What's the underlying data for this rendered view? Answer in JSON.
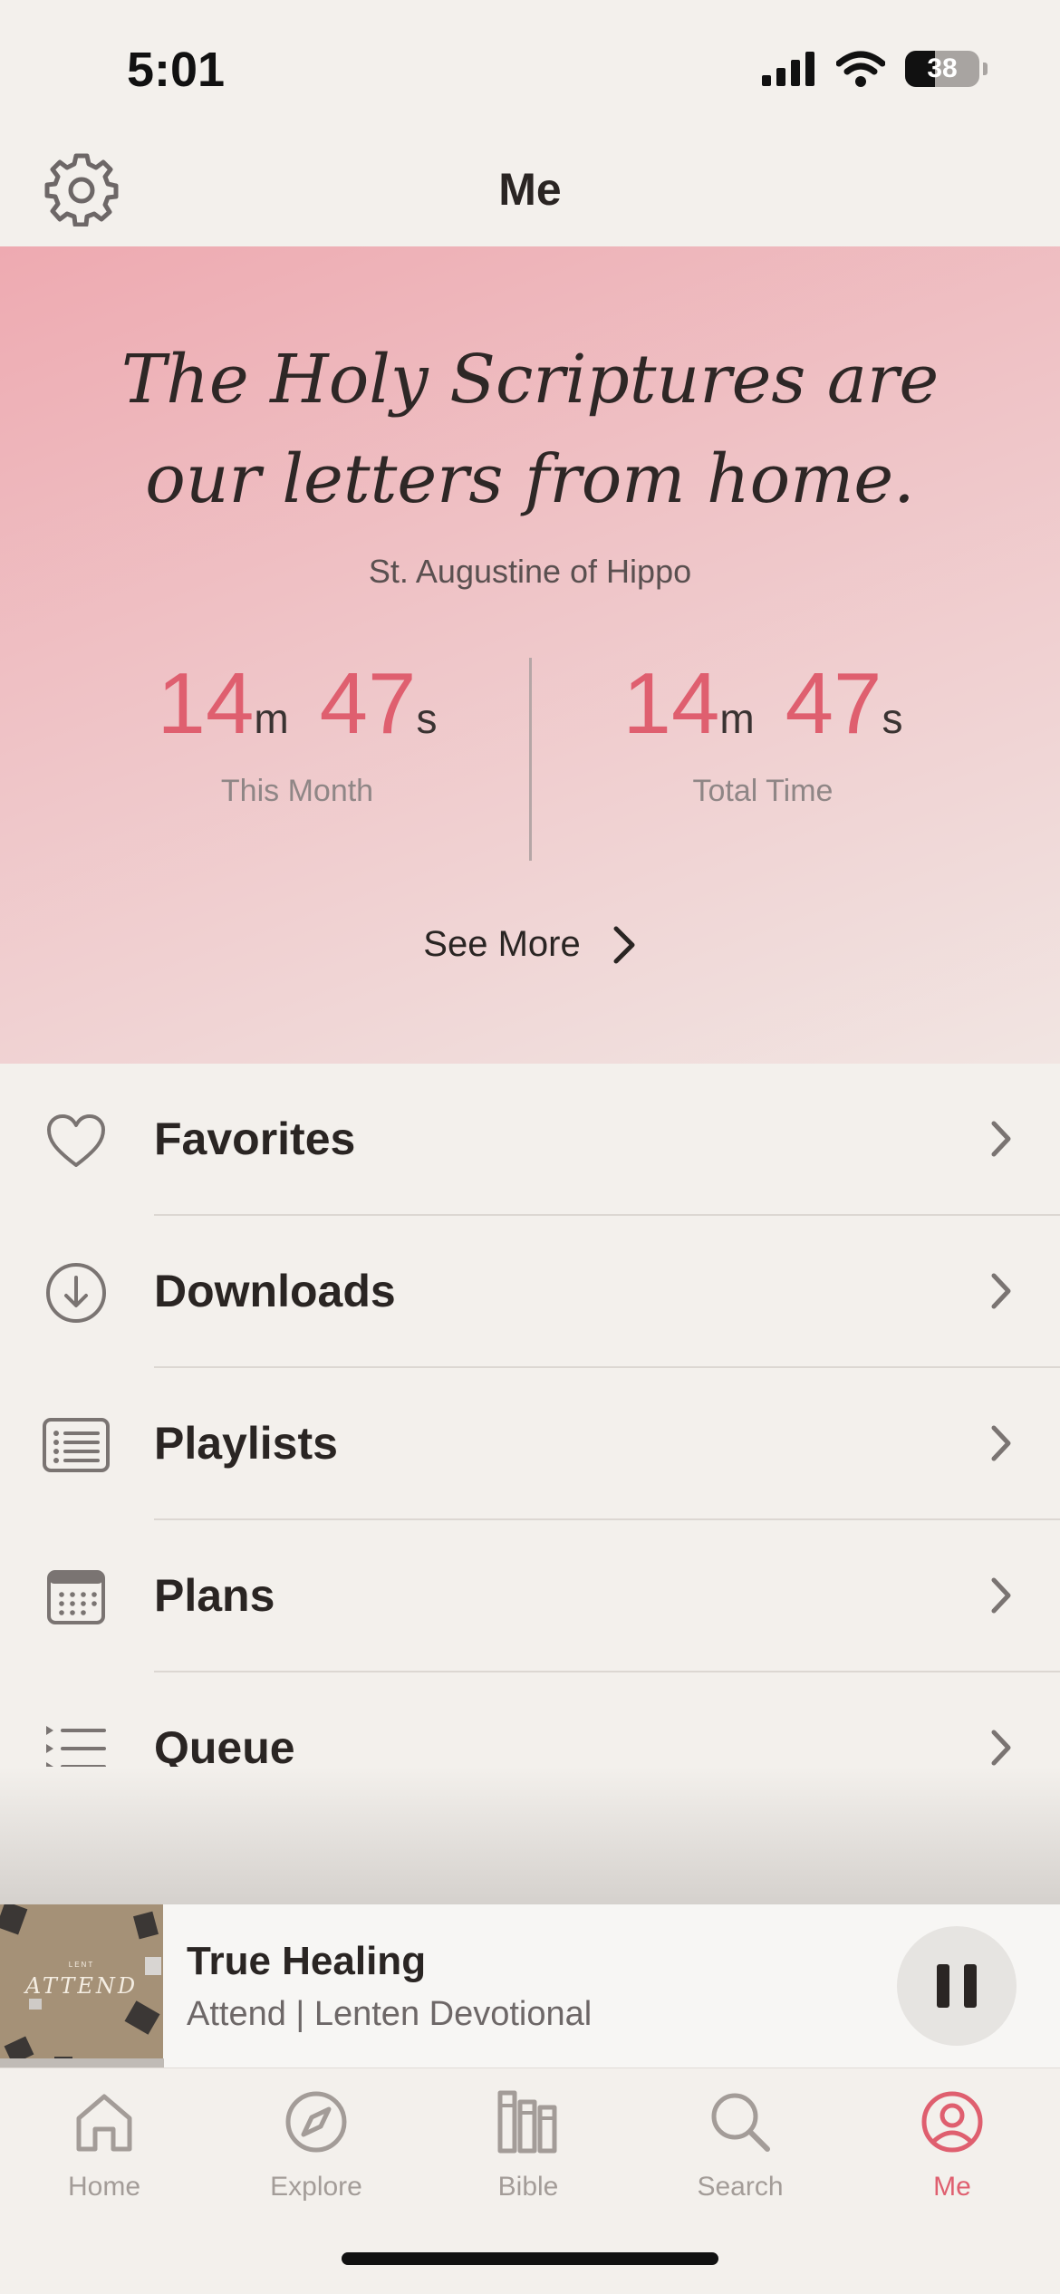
{
  "status_bar": {
    "time": "5:01",
    "battery": "38"
  },
  "header": {
    "title": "Me"
  },
  "hero": {
    "quote": "The Holy Scriptures are our letters from home.",
    "author": "St. Augustine of Hippo",
    "stats": [
      {
        "minutes": "14",
        "minutes_unit": "m",
        "seconds": "47",
        "seconds_unit": "s",
        "label": "This Month"
      },
      {
        "minutes": "14",
        "minutes_unit": "m",
        "seconds": "47",
        "seconds_unit": "s",
        "label": "Total Time"
      }
    ],
    "see_more": "See More"
  },
  "menu": {
    "items": [
      {
        "label": "Favorites",
        "icon": "heart-icon"
      },
      {
        "label": "Downloads",
        "icon": "download-icon"
      },
      {
        "label": "Playlists",
        "icon": "playlist-icon"
      },
      {
        "label": "Plans",
        "icon": "calendar-icon"
      },
      {
        "label": "Queue",
        "icon": "queue-icon"
      }
    ]
  },
  "player": {
    "artwork_text": "ATTEND",
    "artwork_subtext": "LENT",
    "title": "True Healing",
    "subtitle": "Attend | Lenten Devotional",
    "progress": 0.155
  },
  "tabs": [
    {
      "label": "Home",
      "icon": "home-icon",
      "active": false
    },
    {
      "label": "Explore",
      "icon": "compass-icon",
      "active": false
    },
    {
      "label": "Bible",
      "icon": "bible-icon",
      "active": false
    },
    {
      "label": "Search",
      "icon": "search-icon",
      "active": false
    },
    {
      "label": "Me",
      "icon": "profile-icon",
      "active": true
    }
  ],
  "colors": {
    "accent": "#df5f6f",
    "background": "#f3f0ec",
    "text": "#2a2523",
    "muted": "#a39c98"
  }
}
